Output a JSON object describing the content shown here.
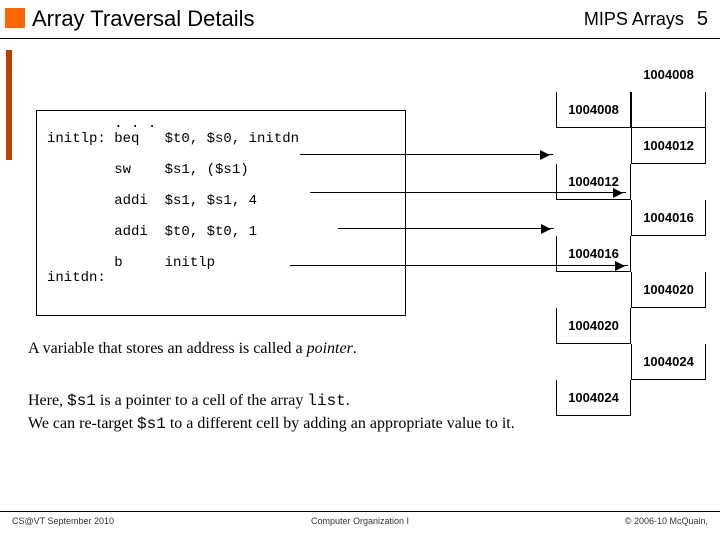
{
  "header": {
    "title": "Array Traversal Details",
    "section": "MIPS Arrays",
    "page": "5"
  },
  "code": "        . . .\ninitlp: beq   $t0, $s0, initdn\n\n        sw    $s1, ($s1)\n\n        addi  $s1, $s1, 4\n\n        addi  $t0, $t0, 1\n\n        b     initlp\ninitdn:",
  "mem": {
    "r0": {
      "l": "",
      "r": "1004008"
    },
    "r1": {
      "l": "1004008",
      "r": ""
    },
    "r2": {
      "l": "",
      "r": "1004012"
    },
    "r3": {
      "l": "1004012",
      "r": ""
    },
    "r4": {
      "l": "",
      "r": "1004016"
    },
    "r5": {
      "l": "1004016",
      "r": ""
    },
    "r6": {
      "l": "",
      "r": "1004020"
    },
    "r7": {
      "l": "1004020",
      "r": ""
    },
    "r8": {
      "l": "",
      "r": "1004024"
    },
    "r9": {
      "l": "1004024",
      "r": ""
    }
  },
  "text": {
    "p1a": "A variable that stores an address is called a ",
    "p1b": "pointer",
    "p1c": ".",
    "p2a": "Here, ",
    "p2b": "$s1",
    "p2c": " is a pointer to a cell of the array ",
    "p2d": "list",
    "p2e": ".",
    "p2f": "We can re-target ",
    "p2g": "$s1",
    "p2h": " to a different cell by adding an appropriate value to it."
  },
  "footer": {
    "left": "CS@VT September 2010",
    "mid": "Computer Organization I",
    "right": "© 2006-10 McQuain,"
  }
}
